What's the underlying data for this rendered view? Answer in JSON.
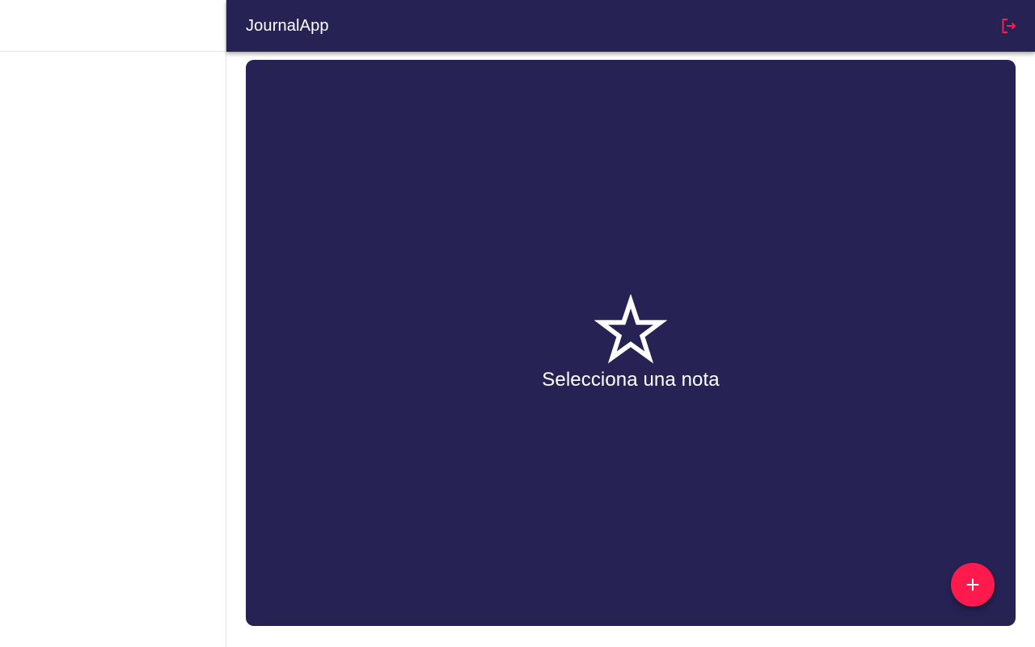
{
  "app": {
    "title": "JournalApp"
  },
  "header": {
    "logout_icon": "logout-icon"
  },
  "main": {
    "empty_icon": "star-outline-icon",
    "empty_message": "Selecciona una nota"
  },
  "fab": {
    "icon": "add-icon"
  },
  "colors": {
    "primary": "#262254",
    "accent": "#ff1a4d",
    "text_light": "#ffffff",
    "sidebar_bg": "#ffffff"
  }
}
